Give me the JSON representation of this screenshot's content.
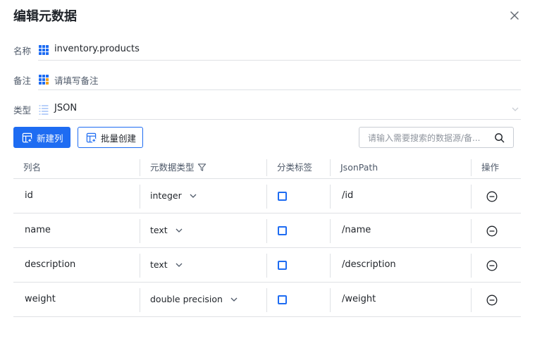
{
  "dialog": {
    "title": "编辑元数据"
  },
  "form": {
    "name": {
      "label": "名称",
      "value": "inventory.products",
      "icon": "grid-icon"
    },
    "remark": {
      "label": "备注",
      "placeholder": "请填写备注",
      "icon": "grid-icon"
    },
    "type": {
      "label": "类型",
      "value": "JSON",
      "icon": "list-icon"
    }
  },
  "toolbar": {
    "new_column_label": "新建列",
    "batch_create_label": "批量创建",
    "search_placeholder": "请输入需要搜索的数据源/备..."
  },
  "table": {
    "headers": {
      "column_name": "列名",
      "metadata_type": "元数据类型",
      "category_tag": "分类标签",
      "json_path": "JsonPath",
      "actions": "操作"
    },
    "rows": [
      {
        "name": "id",
        "type": "integer",
        "tagged": false,
        "path": "/id"
      },
      {
        "name": "name",
        "type": "text",
        "tagged": false,
        "path": "/name"
      },
      {
        "name": "description",
        "type": "text",
        "tagged": false,
        "path": "/description"
      },
      {
        "name": "weight",
        "type": "double precision",
        "tagged": false,
        "path": "/weight"
      }
    ]
  },
  "colors": {
    "accent": "#1e6cf2",
    "border": "#dfe1e5",
    "muted_text": "#4e5969"
  }
}
